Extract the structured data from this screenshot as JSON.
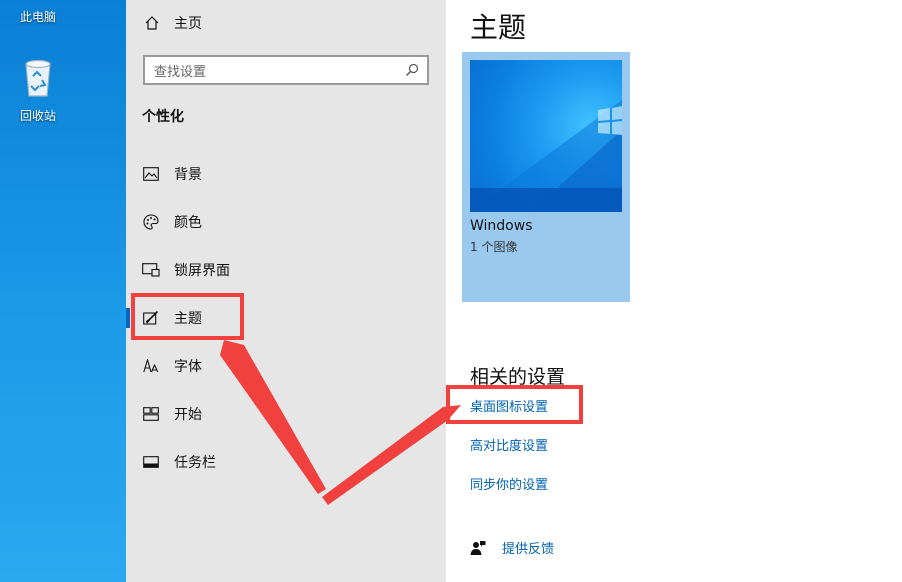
{
  "desktop": {
    "this_pc_label": "此电脑",
    "recycle_bin_label": "回收站"
  },
  "sidebar": {
    "home_label": "主页",
    "search_placeholder": "查找设置",
    "section_title": "个性化",
    "items": [
      {
        "label": "背景",
        "icon": "image-icon"
      },
      {
        "label": "颜色",
        "icon": "palette-icon"
      },
      {
        "label": "锁屏界面",
        "icon": "lock-screen-icon"
      },
      {
        "label": "主题",
        "icon": "theme-brush-icon",
        "active": true
      },
      {
        "label": "字体",
        "icon": "font-icon"
      },
      {
        "label": "开始",
        "icon": "start-grid-icon"
      },
      {
        "label": "任务栏",
        "icon": "taskbar-icon"
      }
    ]
  },
  "main": {
    "title": "主题",
    "theme_card": {
      "name": "Windows",
      "count": "1 个图像"
    },
    "related_title": "相关的设置",
    "links": [
      "桌面图标设置",
      "高对比度设置",
      "同步你的设置"
    ],
    "feedback_label": "提供反馈"
  },
  "colors": {
    "accent": "#0067c0",
    "link": "#0063b1",
    "annotation_red": "#f0413f",
    "sidebar_bg": "#e6e6e6"
  }
}
